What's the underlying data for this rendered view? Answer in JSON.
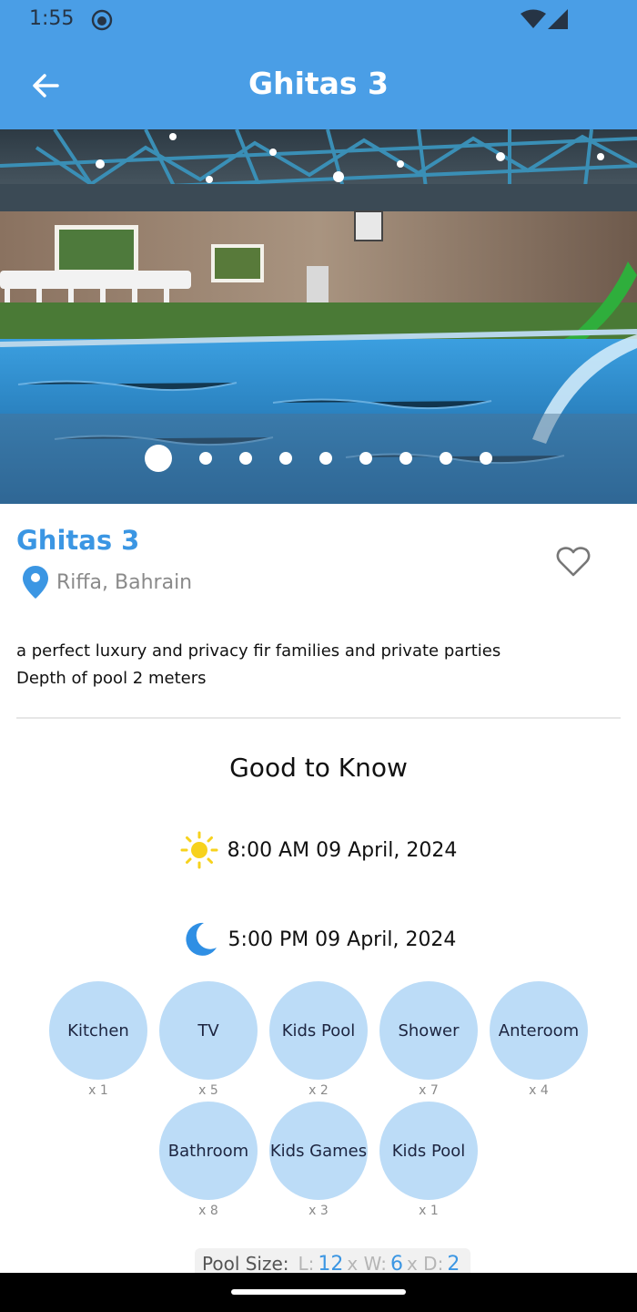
{
  "status": {
    "time": "1:55"
  },
  "appbar": {
    "title": "Ghitas 3",
    "back_icon": "arrow-left-icon"
  },
  "hero": {
    "slide_count": 9,
    "active_slide": 0
  },
  "listing": {
    "title": "Ghitas 3",
    "location": "Riffa, Bahrain",
    "description_lines": [
      "a perfect luxury and privacy fir families and private parties",
      "Depth of pool 2 meters"
    ]
  },
  "good_to_know": {
    "title": "Good to Know",
    "check_in": "8:00 AM 09 April, 2024",
    "check_out": "5:00 PM 09 April, 2024"
  },
  "amenities": [
    {
      "label": "Kitchen",
      "count": "x 1"
    },
    {
      "label": "TV",
      "count": "x 5"
    },
    {
      "label": "Kids Pool",
      "count": "x 2"
    },
    {
      "label": "Shower",
      "count": "x 7"
    },
    {
      "label": "Anteroom",
      "count": "x 4"
    },
    {
      "label": "Bathroom",
      "count": "x 8"
    },
    {
      "label": "Kids Games",
      "count": "x 3"
    },
    {
      "label": "Kids Pool",
      "count": "x 1"
    }
  ],
  "pool_size": {
    "label": "Pool Size:",
    "l_label": "L:",
    "l_value": "12",
    "w_label": "x W:",
    "w_value": "6",
    "d_label": "x D:",
    "d_value": "2"
  },
  "colors": {
    "primary": "#4a9ee6",
    "accent": "#3b96e3",
    "amenity_bg": "#bcdcf7",
    "sun": "#f7d21c",
    "moon": "#2f8fe4"
  }
}
